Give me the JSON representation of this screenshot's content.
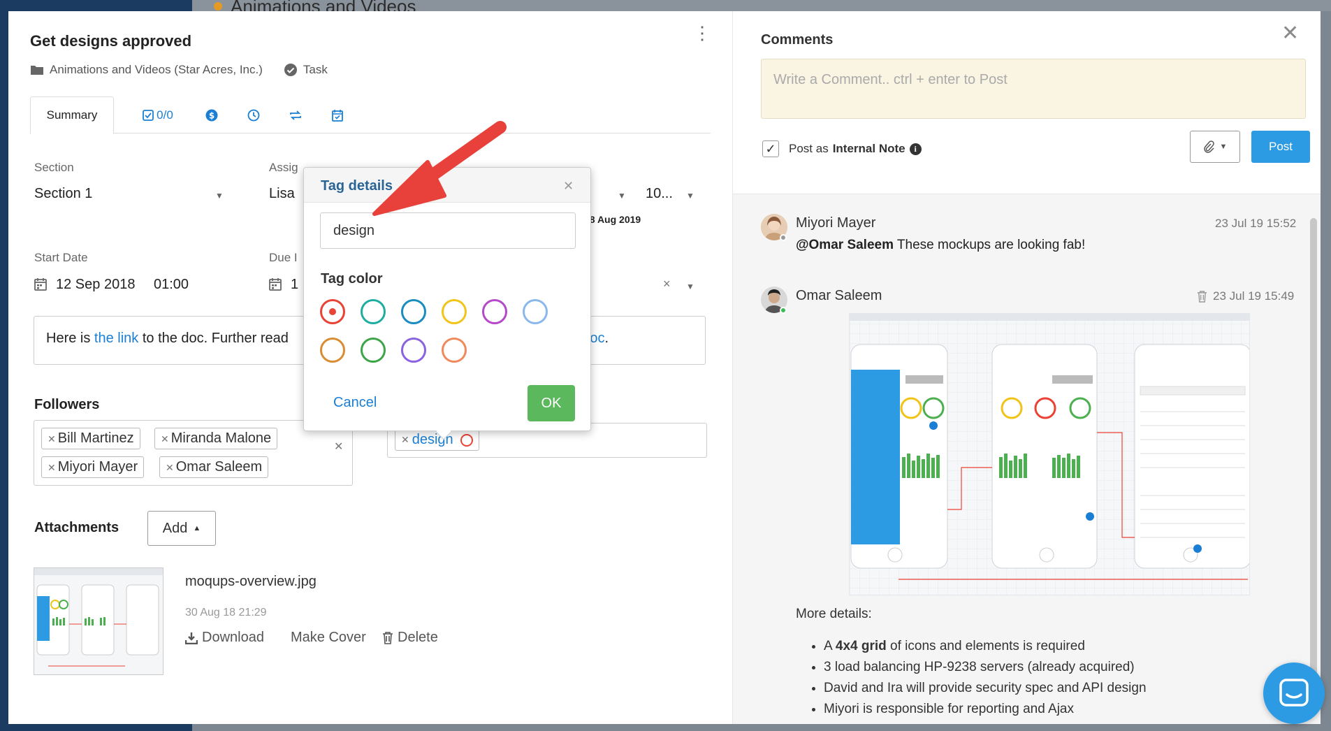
{
  "background": {
    "page_title": "Animations and Videos"
  },
  "task": {
    "title": "Get designs approved",
    "project": "Animations and Videos (Star Acres, Inc.)",
    "type": "Task"
  },
  "tabs": [
    {
      "label": "Summary"
    },
    {
      "label": "0/0"
    }
  ],
  "fields": {
    "section_label": "Section",
    "section_value": "Section 1",
    "assignee_label": "Assig",
    "assignee_value": "Lisa",
    "due_extra_date": "18 Aug 2019",
    "priority_value": "10...",
    "start_label": "Start Date",
    "start_date": "12 Sep 2018",
    "start_time": "01:00",
    "due_label": "Due I",
    "due_value": "1"
  },
  "description": {
    "prefix": "Here is ",
    "link1": "the link",
    "mid": " to the doc. Further read",
    "link2": "le Doc",
    "suffix": "."
  },
  "followers": {
    "heading": "Followers",
    "items": [
      "Bill Martinez",
      "Miranda Malone",
      "Miyori Mayer",
      "Omar Saleem"
    ]
  },
  "tags": {
    "items": [
      "design"
    ]
  },
  "attachments": {
    "heading": "Attachments",
    "add_label": "Add",
    "file_name": "moqups-overview.jpg",
    "file_date": "30 Aug 18 21:29",
    "download": "Download",
    "make_cover": "Make Cover",
    "delete": "Delete"
  },
  "tag_popover": {
    "title": "Tag details",
    "input_value": "design",
    "color_label": "Tag color",
    "colors": [
      "#ea4335",
      "#1fada0",
      "#1a8cbf",
      "#f0c419",
      "#b44ac8",
      "#8ab8ec",
      "#d98d33",
      "#3da547",
      "#8b63e0",
      "#f08a5d"
    ],
    "selected_index": 0,
    "cancel": "Cancel",
    "ok": "OK"
  },
  "comments": {
    "heading": "Comments",
    "placeholder": "Write a Comment.. ctrl + enter to Post",
    "post_as_prefix": "Post as",
    "post_as_bold": "Internal Note",
    "post_button": "Post",
    "items": [
      {
        "author": "Miyori Mayer",
        "time": "23 Jul 19 15:52",
        "mention": "@Omar Saleem",
        "text": " These mockups are looking fab!"
      },
      {
        "author": "Omar Saleem",
        "time": "23 Jul 19 15:49"
      }
    ],
    "more_details": "More details:",
    "bullets": [
      {
        "pre": "A ",
        "bold": "4x4 grid",
        "post": " of icons and elements is required"
      },
      {
        "pre": "3 load balancing HP-9238 servers (already acquired)",
        "bold": "",
        "post": ""
      },
      {
        "pre": "David and Ira will provide security spec and API design",
        "bold": "",
        "post": ""
      },
      {
        "pre": "Miyori is responsible for reporting and Ajax",
        "bold": "",
        "post": ""
      }
    ]
  },
  "colors": {
    "accent": "#1a7fd4",
    "ok_green": "#5cb85c",
    "post_blue": "#2d9be3",
    "arrow_red": "#e8403a"
  }
}
